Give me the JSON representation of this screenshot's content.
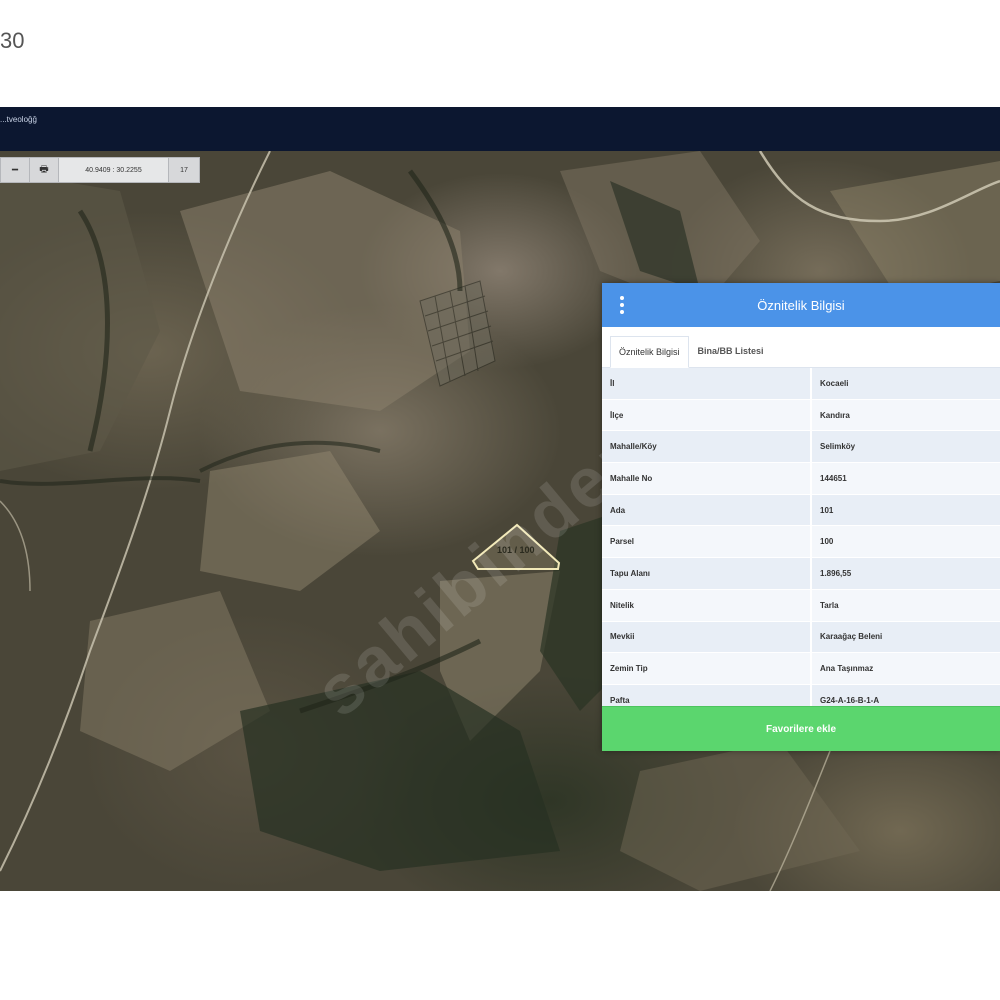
{
  "corner_text": "30",
  "app": {
    "title": "...tveoloğğ"
  },
  "toolbar": {
    "coordinates": "40.9409 : 30.2255",
    "zoom_level": "17"
  },
  "map": {
    "parcel_label": "101 / 100"
  },
  "panel": {
    "title": "Öznitelik Bilgisi",
    "tabs": [
      {
        "label": "Öznitelik Bilgisi",
        "active": true
      },
      {
        "label": "Bina/BB Listesi",
        "active": false
      }
    ],
    "rows": [
      {
        "key": "İl",
        "value": "Kocaeli"
      },
      {
        "key": "İlçe",
        "value": "Kandıra"
      },
      {
        "key": "Mahalle/Köy",
        "value": "Selimköy"
      },
      {
        "key": "Mahalle No",
        "value": "144651"
      },
      {
        "key": "Ada",
        "value": "101"
      },
      {
        "key": "Parsel",
        "value": "100"
      },
      {
        "key": "Tapu Alanı",
        "value": "1.896,55"
      },
      {
        "key": "Nitelik",
        "value": "Tarla"
      },
      {
        "key": "Mevkii",
        "value": "Karaağaç Beleni"
      },
      {
        "key": "Zemin Tip",
        "value": "Ana Taşınmaz"
      },
      {
        "key": "Pafta",
        "value": "G24-A-16-B-1-A"
      }
    ],
    "favorite_button": "Favorilere ekle"
  },
  "colors": {
    "header": "#4b93e8",
    "favorite": "#5bd66e",
    "titlebar": "#0c1730"
  }
}
